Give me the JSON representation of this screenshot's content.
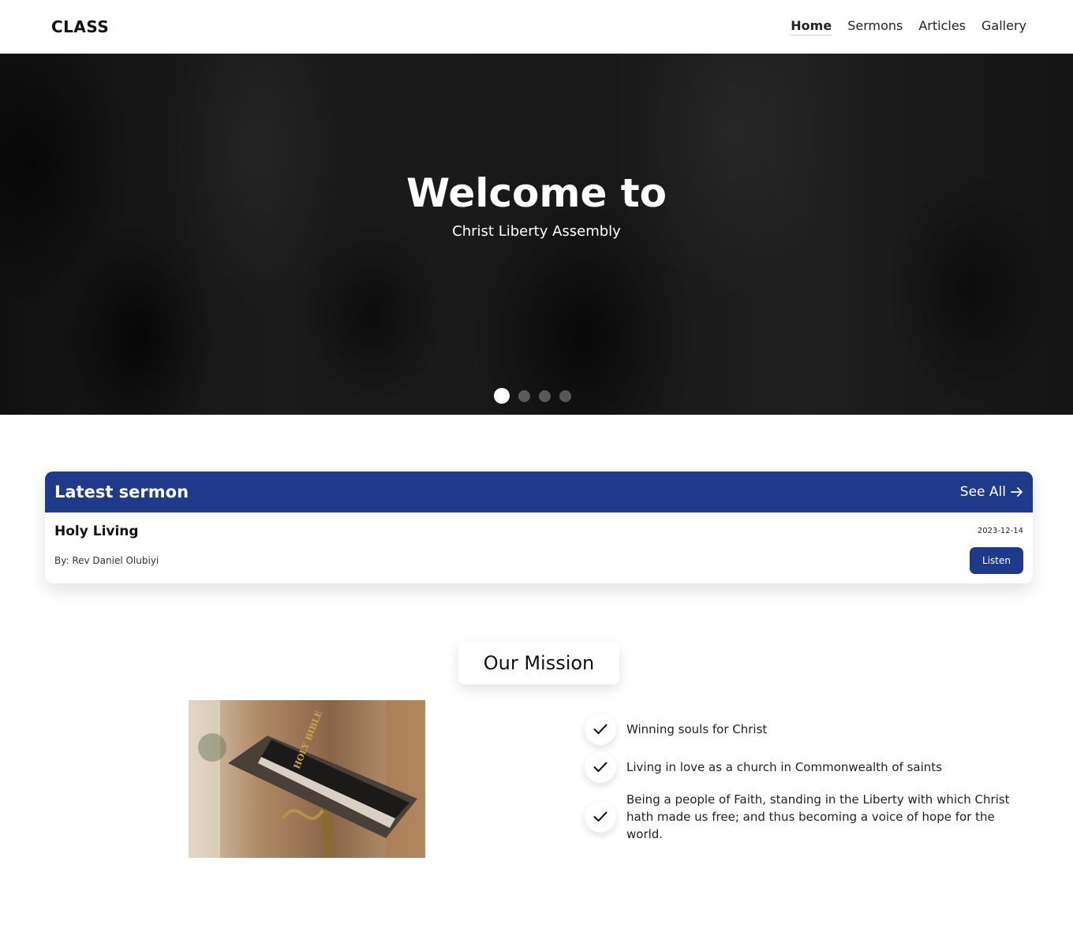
{
  "navbar": {
    "brand": "CLASS",
    "links": [
      {
        "label": "Home",
        "active": true
      },
      {
        "label": "Sermons",
        "active": false
      },
      {
        "label": "Articles",
        "active": false
      },
      {
        "label": "Gallery",
        "active": false
      }
    ]
  },
  "hero": {
    "title": "Welcome to",
    "subtitle": "Christ Liberty Assembly",
    "slide_count": 4,
    "active_slide": 1
  },
  "latest_sermon": {
    "header": "Latest sermon",
    "see_all_label": "See All",
    "see_all_icon": "arrow-right-icon",
    "title": "Holy Living",
    "date": "2023-12-14",
    "author": "By: Rev Daniel Olubiyi",
    "listen_label": "Listen",
    "accent_color": "#1f3a8a"
  },
  "mission": {
    "title": "Our Mission",
    "image_icon": "bible-on-lectern-image",
    "items": [
      {
        "icon": "check-icon",
        "text": "Winning souls for Christ"
      },
      {
        "icon": "check-icon",
        "text": "Living in love as a church in Commonwealth of saints"
      },
      {
        "icon": "check-icon",
        "text": "Being a people of Faith, standing in the Liberty with which Christ hath made us free; and thus becoming a voice of hope for the world."
      }
    ]
  }
}
